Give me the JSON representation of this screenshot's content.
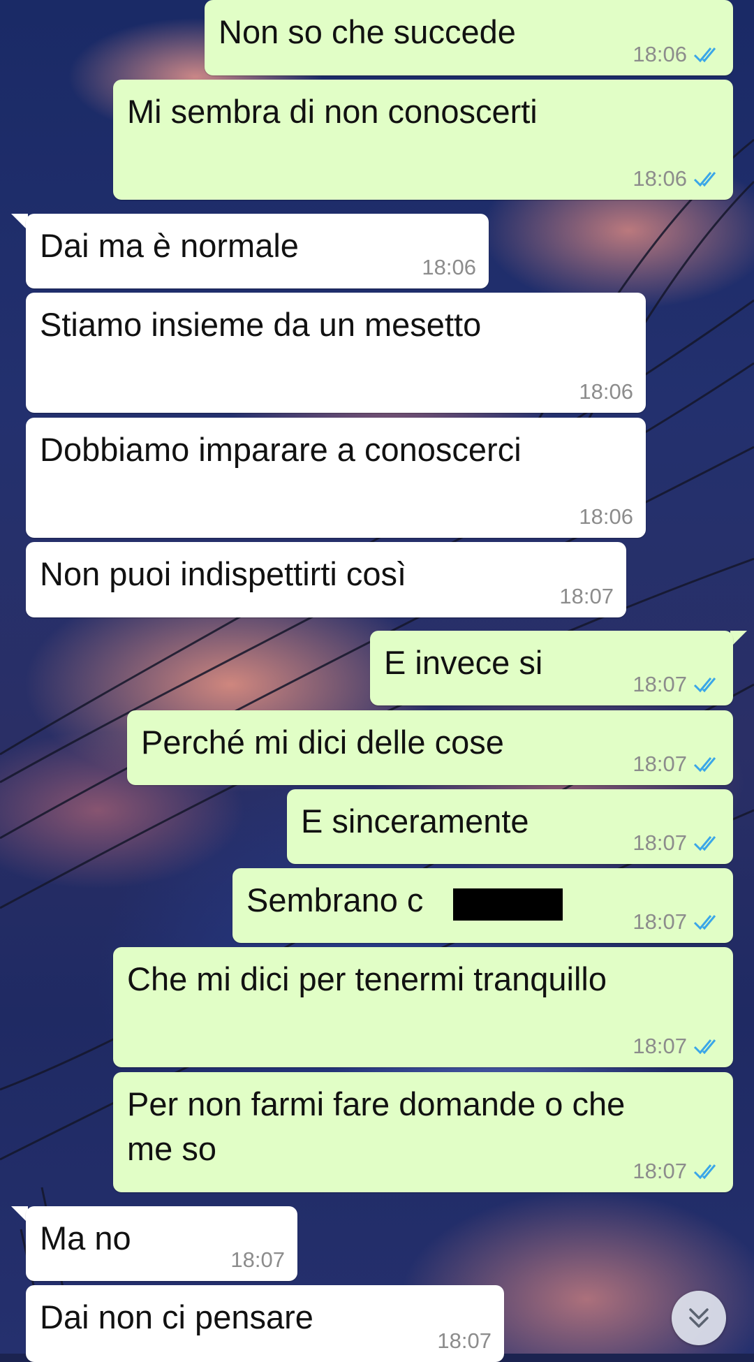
{
  "messages": [
    {
      "text": "Non so che succede",
      "time": "18:06",
      "direction": "out",
      "status": "read"
    },
    {
      "text": "Mi sembra di non conoscerti",
      "time": "18:06",
      "direction": "out",
      "status": "read"
    },
    {
      "text": "Dai ma è normale",
      "time": "18:06",
      "direction": "in"
    },
    {
      "text": "Stiamo insieme da un mesetto",
      "time": "18:06",
      "direction": "in"
    },
    {
      "text": "Dobbiamo imparare a conoscerci",
      "time": "18:06",
      "direction": "in"
    },
    {
      "text": "Non puoi indispettirti così",
      "time": "18:07",
      "direction": "in"
    },
    {
      "text": "E invece si",
      "time": "18:07",
      "direction": "out",
      "status": "read"
    },
    {
      "text": "Perché mi dici delle cose",
      "time": "18:07",
      "direction": "out",
      "status": "read"
    },
    {
      "text": "E sinceramente",
      "time": "18:07",
      "direction": "out",
      "status": "read"
    },
    {
      "text": "Sembrano c",
      "time": "18:07",
      "direction": "out",
      "status": "read"
    },
    {
      "text": "Che mi dici per tenermi tranquillo",
      "time": "18:07",
      "direction": "out",
      "status": "read"
    },
    {
      "text": "Per non farmi fare domande o che",
      "text_line2": "me so",
      "time": "18:07",
      "direction": "out",
      "status": "read"
    },
    {
      "text": "Ma no",
      "time": "18:07",
      "direction": "in"
    },
    {
      "text": "Dai non ci pensare",
      "time": "18:07",
      "direction": "in"
    }
  ],
  "colors": {
    "outgoing_bubble": "#e1fec6",
    "incoming_bubble": "#ffffff",
    "timestamp": "#8c8c8c",
    "read_ticks": "#3aa6e8"
  },
  "icons": {
    "read_receipt": "double-check-icon",
    "scroll_down": "double-chevron-down-icon"
  }
}
